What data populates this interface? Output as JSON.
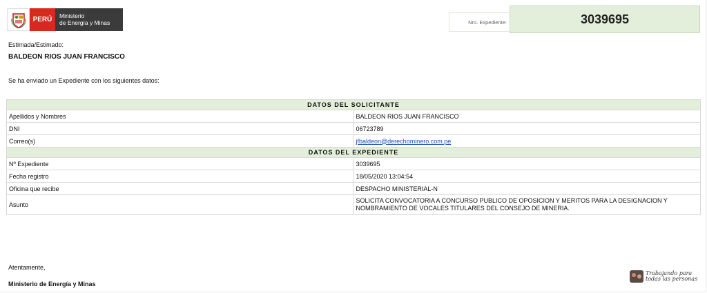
{
  "header": {
    "country": "PERÚ",
    "ministry_line1": "Ministerio",
    "ministry_line2": "de Energía y Minas",
    "shield_icon": "peru-coat-of-arms-icon",
    "expediente_label": "Nro. Expediente:",
    "expediente_value": "3039695"
  },
  "greeting": {
    "label": "Estimada/Estimado:",
    "name": "BALDEON RIOS JUAN FRANCISCO"
  },
  "intro": "Se ha enviado un Expediente con los siguientes datos:",
  "solicitante": {
    "title": "DATOS DEL SOLICITANTE",
    "rows": [
      {
        "label": "Apellidos y Nombres",
        "value": "BALDEON RIOS JUAN FRANCISCO"
      },
      {
        "label": "DNI",
        "value": "06723789"
      },
      {
        "label": "Correo(s)",
        "value": "jfbaldeon@derechominero.com.pe"
      }
    ]
  },
  "expediente": {
    "title": "DATOS DEL EXPEDIENTE",
    "rows": [
      {
        "label": "Nº Expediente",
        "value": "3039695"
      },
      {
        "label": "Fecha registro",
        "value": "18/05/2020 13:04:54"
      },
      {
        "label": "Oficina que recibe",
        "value": "DESPACHO MINISTERIAL-N"
      },
      {
        "label": "Asunto",
        "value": "SOLICITA CONVOCATORIA A CONCURSO PUBLICO DE OPOSICION Y MERITOS PARA LA DESIGNACION Y NOMBRAMIENTO DE VOCALES TITULARES DEL CONSEJO DE MINERIA."
      }
    ]
  },
  "closing": {
    "line1": "Atentamente,",
    "line2": "Ministerio de Energía y Minas"
  },
  "slogan": {
    "line1": "Trabajando para",
    "line2": "todas las personas"
  },
  "colors": {
    "accent_green": "#e3efdb",
    "peru_red": "#d52b1e",
    "ministry_gray": "#3b3b3b",
    "link_blue": "#1a4fb5"
  }
}
